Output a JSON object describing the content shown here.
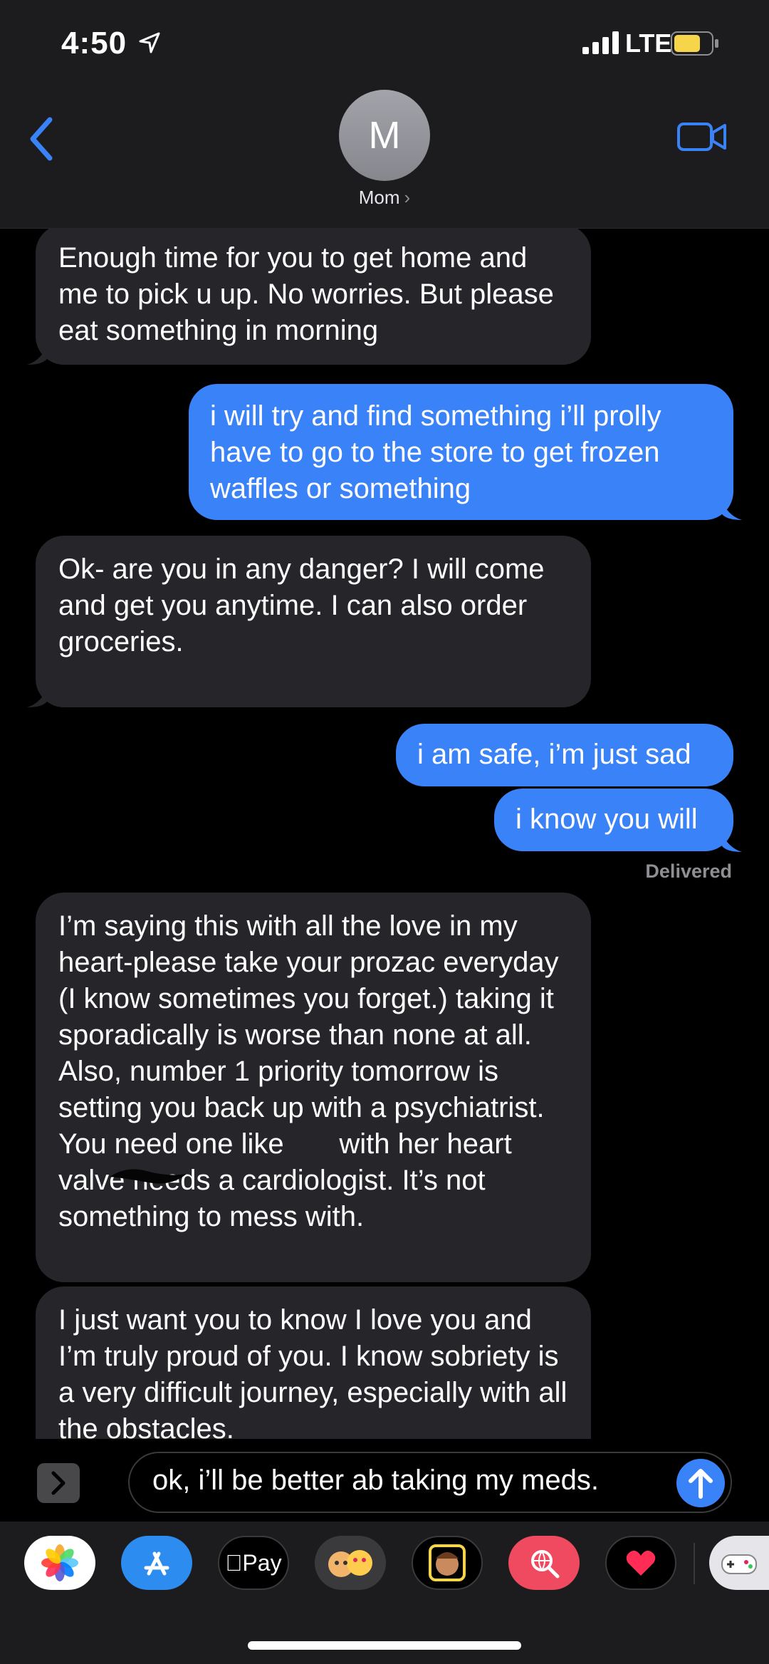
{
  "status_bar": {
    "time": "4:50",
    "carrier": "LTE",
    "icons": [
      "location-arrow-icon",
      "signal-icon",
      "battery-icon"
    ]
  },
  "header": {
    "avatar_initial": "M",
    "contact_name": "Mom",
    "contact_chevron": "›",
    "icons": [
      "back-chevron-icon",
      "video-call-icon"
    ]
  },
  "messages": [
    {
      "direction": "incoming",
      "text": "Enough time for you to get home and me to pick u up. No worries. But please eat something in morning"
    },
    {
      "direction": "outgoing",
      "text": "i will try and find something i’ll prolly have to go to the store to get frozen waffles or something"
    },
    {
      "direction": "incoming",
      "text": "Ok- are you in any danger? I will come and get you anytime. I can also order groceries."
    },
    {
      "direction": "outgoing",
      "text": "i am safe, i’m just sad"
    },
    {
      "direction": "outgoing",
      "text": "i know you will"
    },
    {
      "direction": "incoming",
      "text": "I’m saying this with all the love in my heart-please take your prozac everyday (I know sometimes you forget.) taking it sporadically is worse than none at all. Also, number 1 priority tomorrow is setting you back up with a psychiatrist. You need one like       with her heart valve needs a cardiologist. It’s not something to mess with."
    },
    {
      "direction": "incoming",
      "text": "I just want you to know I love you and I’m truly proud of you. I know sobriety is a very difficult journey, especially with all the obstacles."
    }
  ],
  "delivered_label": "Delivered",
  "composer": {
    "value": "ok, i’ll be better ab taking my meds."
  },
  "app_drawer": {
    "apps": [
      "photos-icon",
      "app-store-icon",
      "apple-pay-icon",
      "memoji-stickers-icon",
      "memoji-icon",
      "search-images-icon",
      "digital-touch-icon",
      "game-icon"
    ],
    "apple_pay_label": "Pay"
  },
  "colors": {
    "outgoing_bubble": "#3a82f7",
    "incoming_bubble": "#26252a",
    "accent": "#3a82f7",
    "header_bg": "#1c1c1e"
  }
}
